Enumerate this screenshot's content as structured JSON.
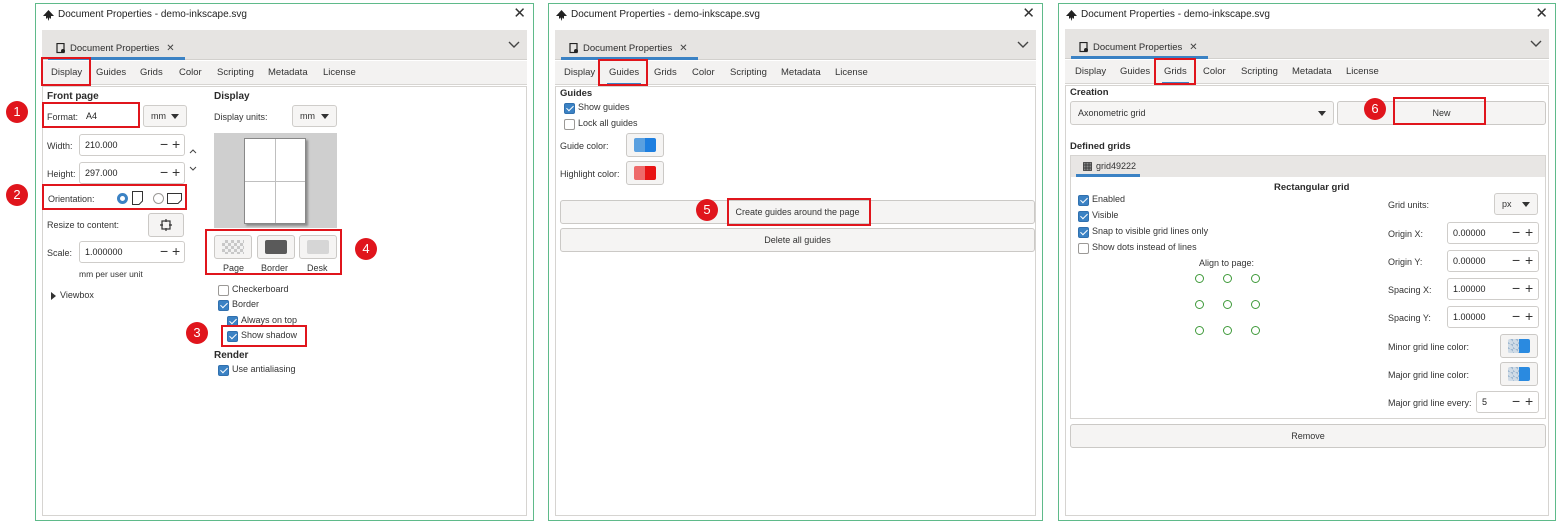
{
  "window_title": "Document Properties - demo-inkscape.svg",
  "dock_tab_label": "Document Properties",
  "tabs": [
    "Display",
    "Guides",
    "Grids",
    "Color",
    "Scripting",
    "Metadata",
    "License"
  ],
  "colors": {
    "accent": "#3b82c4",
    "highlight": "#e0151c",
    "window_border": "#5fba8a"
  },
  "display": {
    "front_page_heading": "Front page",
    "format_label": "Format:",
    "format_value": "A4",
    "format_unit": "mm",
    "width_label": "Width:",
    "width_value": "210.000",
    "height_label": "Height:",
    "height_value": "297.000",
    "orientation_label": "Orientation:",
    "resize_label": "Resize to content:",
    "scale_label": "Scale:",
    "scale_value": "1.000000",
    "scale_unit": "mm per user unit",
    "viewbox_label": "Viewbox",
    "display_heading": "Display",
    "display_units_label": "Display units:",
    "display_units_value": "mm",
    "page_button": "Page",
    "border_button": "Border",
    "desk_button": "Desk",
    "checkerboard": "Checkerboard",
    "border": "Border",
    "always_on_top": "Always on top",
    "show_shadow": "Show shadow",
    "render_heading": "Render",
    "use_antialiasing": "Use antialiasing"
  },
  "guides": {
    "heading": "Guides",
    "show_guides": "Show guides",
    "lock_all_guides": "Lock all guides",
    "guide_color_label": "Guide color:",
    "highlight_color_label": "Highlight color:",
    "create_button": "Create guides around the page",
    "delete_button": "Delete all guides"
  },
  "grids": {
    "creation_heading": "Creation",
    "grid_type": "Axonometric grid",
    "new_button": "New",
    "defined_heading": "Defined grids",
    "grid_tab": "grid49222",
    "grid_kind": "Rectangular grid",
    "enabled": "Enabled",
    "visible": "Visible",
    "snap": "Snap to visible grid lines only",
    "show_dots": "Show dots instead of lines",
    "align_label": "Align to page:",
    "grid_units_label": "Grid units:",
    "grid_units_value": "px",
    "origin_x_label": "Origin X:",
    "origin_x_value": "0.00000",
    "origin_y_label": "Origin Y:",
    "origin_y_value": "0.00000",
    "spacing_x_label": "Spacing X:",
    "spacing_x_value": "1.00000",
    "spacing_y_label": "Spacing Y:",
    "spacing_y_value": "1.00000",
    "minor_color_label": "Minor grid line color:",
    "major_color_label": "Major grid line color:",
    "major_every_label": "Major grid line every:",
    "major_every_value": "5",
    "remove_button": "Remove"
  },
  "badges": [
    "1",
    "2",
    "3",
    "4",
    "5",
    "6"
  ]
}
